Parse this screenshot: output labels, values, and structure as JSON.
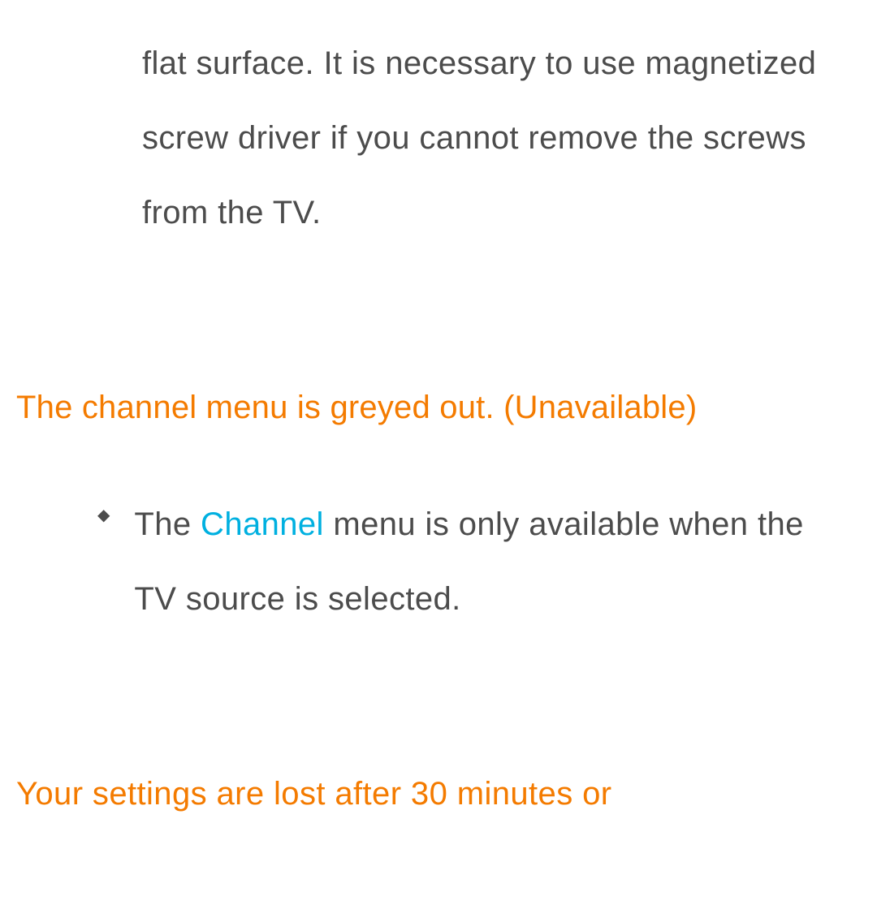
{
  "section1": {
    "bullet_text": "flat surface. It is necessary to use magnetized screw driver if you cannot remove the screws from the TV."
  },
  "section2": {
    "heading": "The channel menu is greyed out. (Unavailable)",
    "bullet_prefix": "The ",
    "bullet_highlight": "Channel",
    "bullet_suffix": " menu is only available when the TV source is selected."
  },
  "section3": {
    "heading": "Your settings are lost after 30 minutes or"
  }
}
